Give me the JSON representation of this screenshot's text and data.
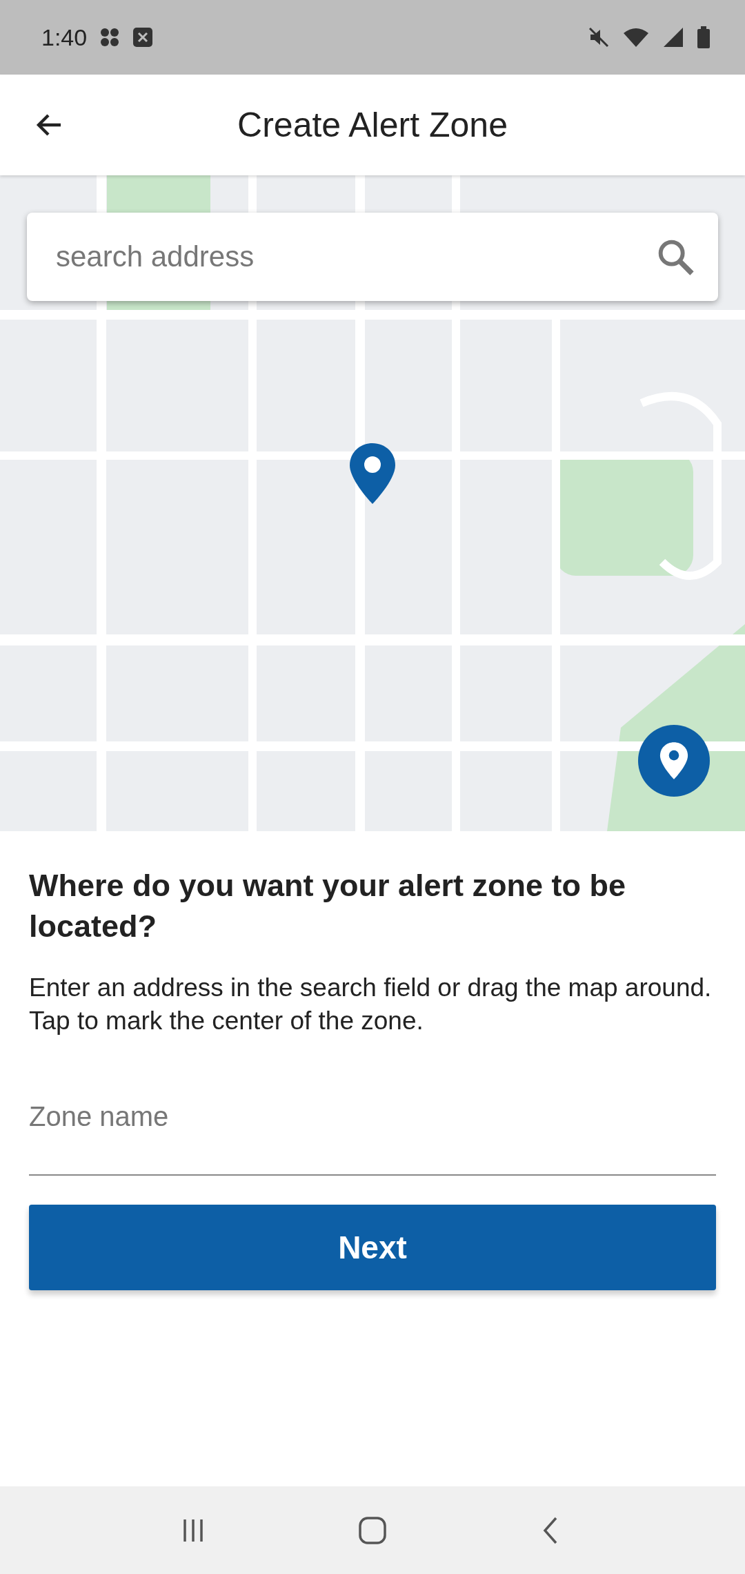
{
  "status_bar": {
    "time": "1:40"
  },
  "app_bar": {
    "title": "Create Alert Zone"
  },
  "map": {
    "kind": "picture",
    "search": {
      "placeholder": "search address"
    }
  },
  "prompt": {
    "heading": "Where do you want your alert zone to be located?",
    "description": "Enter an address in the search field or drag the map around. Tap to mark the center of the zone."
  },
  "zone_name": {
    "placeholder": "Zone name"
  },
  "next_button": {
    "label": "Next"
  }
}
